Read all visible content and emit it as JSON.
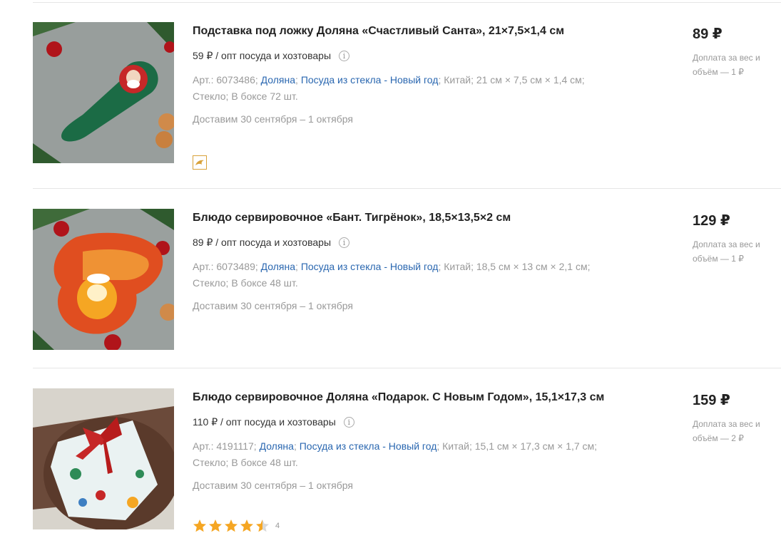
{
  "products": [
    {
      "title": "Подставка под ложку Доляна «Счастливый Санта», 21×7,5×1,4 см",
      "wholesale": "59 ₽ / опт посуда и хозтовары",
      "article": "Арт.: 6073486;",
      "brand": "Доляна",
      "category": "Посуда из стекла - Новый год",
      "spec_line1_tail": "; Китай; 21 см × 7,5 см × 1,4 см;",
      "spec_line2": "Стекло; В боксе 72 шт.",
      "delivery": "Доставим 30 сентября – 1 октября",
      "price": "89 ₽",
      "surcharge": "Доплата за вес и объём — 1 ₽",
      "badge_icon": "dolphin-icon"
    },
    {
      "title": "Блюдо сервировочное «Бант. Тигрёнок», 18,5×13,5×2 см",
      "wholesale": "89 ₽ / опт посуда и хозтовары",
      "article": "Арт.: 6073489;",
      "brand": "Доляна",
      "category": "Посуда из стекла - Новый год",
      "spec_line1_tail": "; Китай; 18,5 см × 13 см × 2,1 см;",
      "spec_line2": "Стекло; В боксе 48 шт.",
      "delivery": "Доставим 30 сентября – 1 октября",
      "price": "129 ₽",
      "surcharge": "Доплата за вес и объём — 1 ₽"
    },
    {
      "title": "Блюдо сервировочное Доляна «Подарок. С Новым Годом», 15,1×17,3 см",
      "wholesale": "110 ₽ / опт посуда и хозтовары",
      "article": "Арт.: 4191117;",
      "brand": "Доляна",
      "category": "Посуда из стекла - Новый год",
      "spec_line1_tail": "; Китай; 15,1 см × 17,3 см × 1,7 см;",
      "spec_line2": "Стекло; В боксе 48 шт.",
      "delivery": "Доставим 30 сентября – 1 октября",
      "price": "159 ₽",
      "surcharge": "Доплата за вес и объём — 2 ₽",
      "rating": 4.5,
      "rating_count": "4"
    }
  ],
  "colors": {
    "link": "#2a67b0",
    "star": "#f5a623",
    "badge": "#d9a23a"
  }
}
